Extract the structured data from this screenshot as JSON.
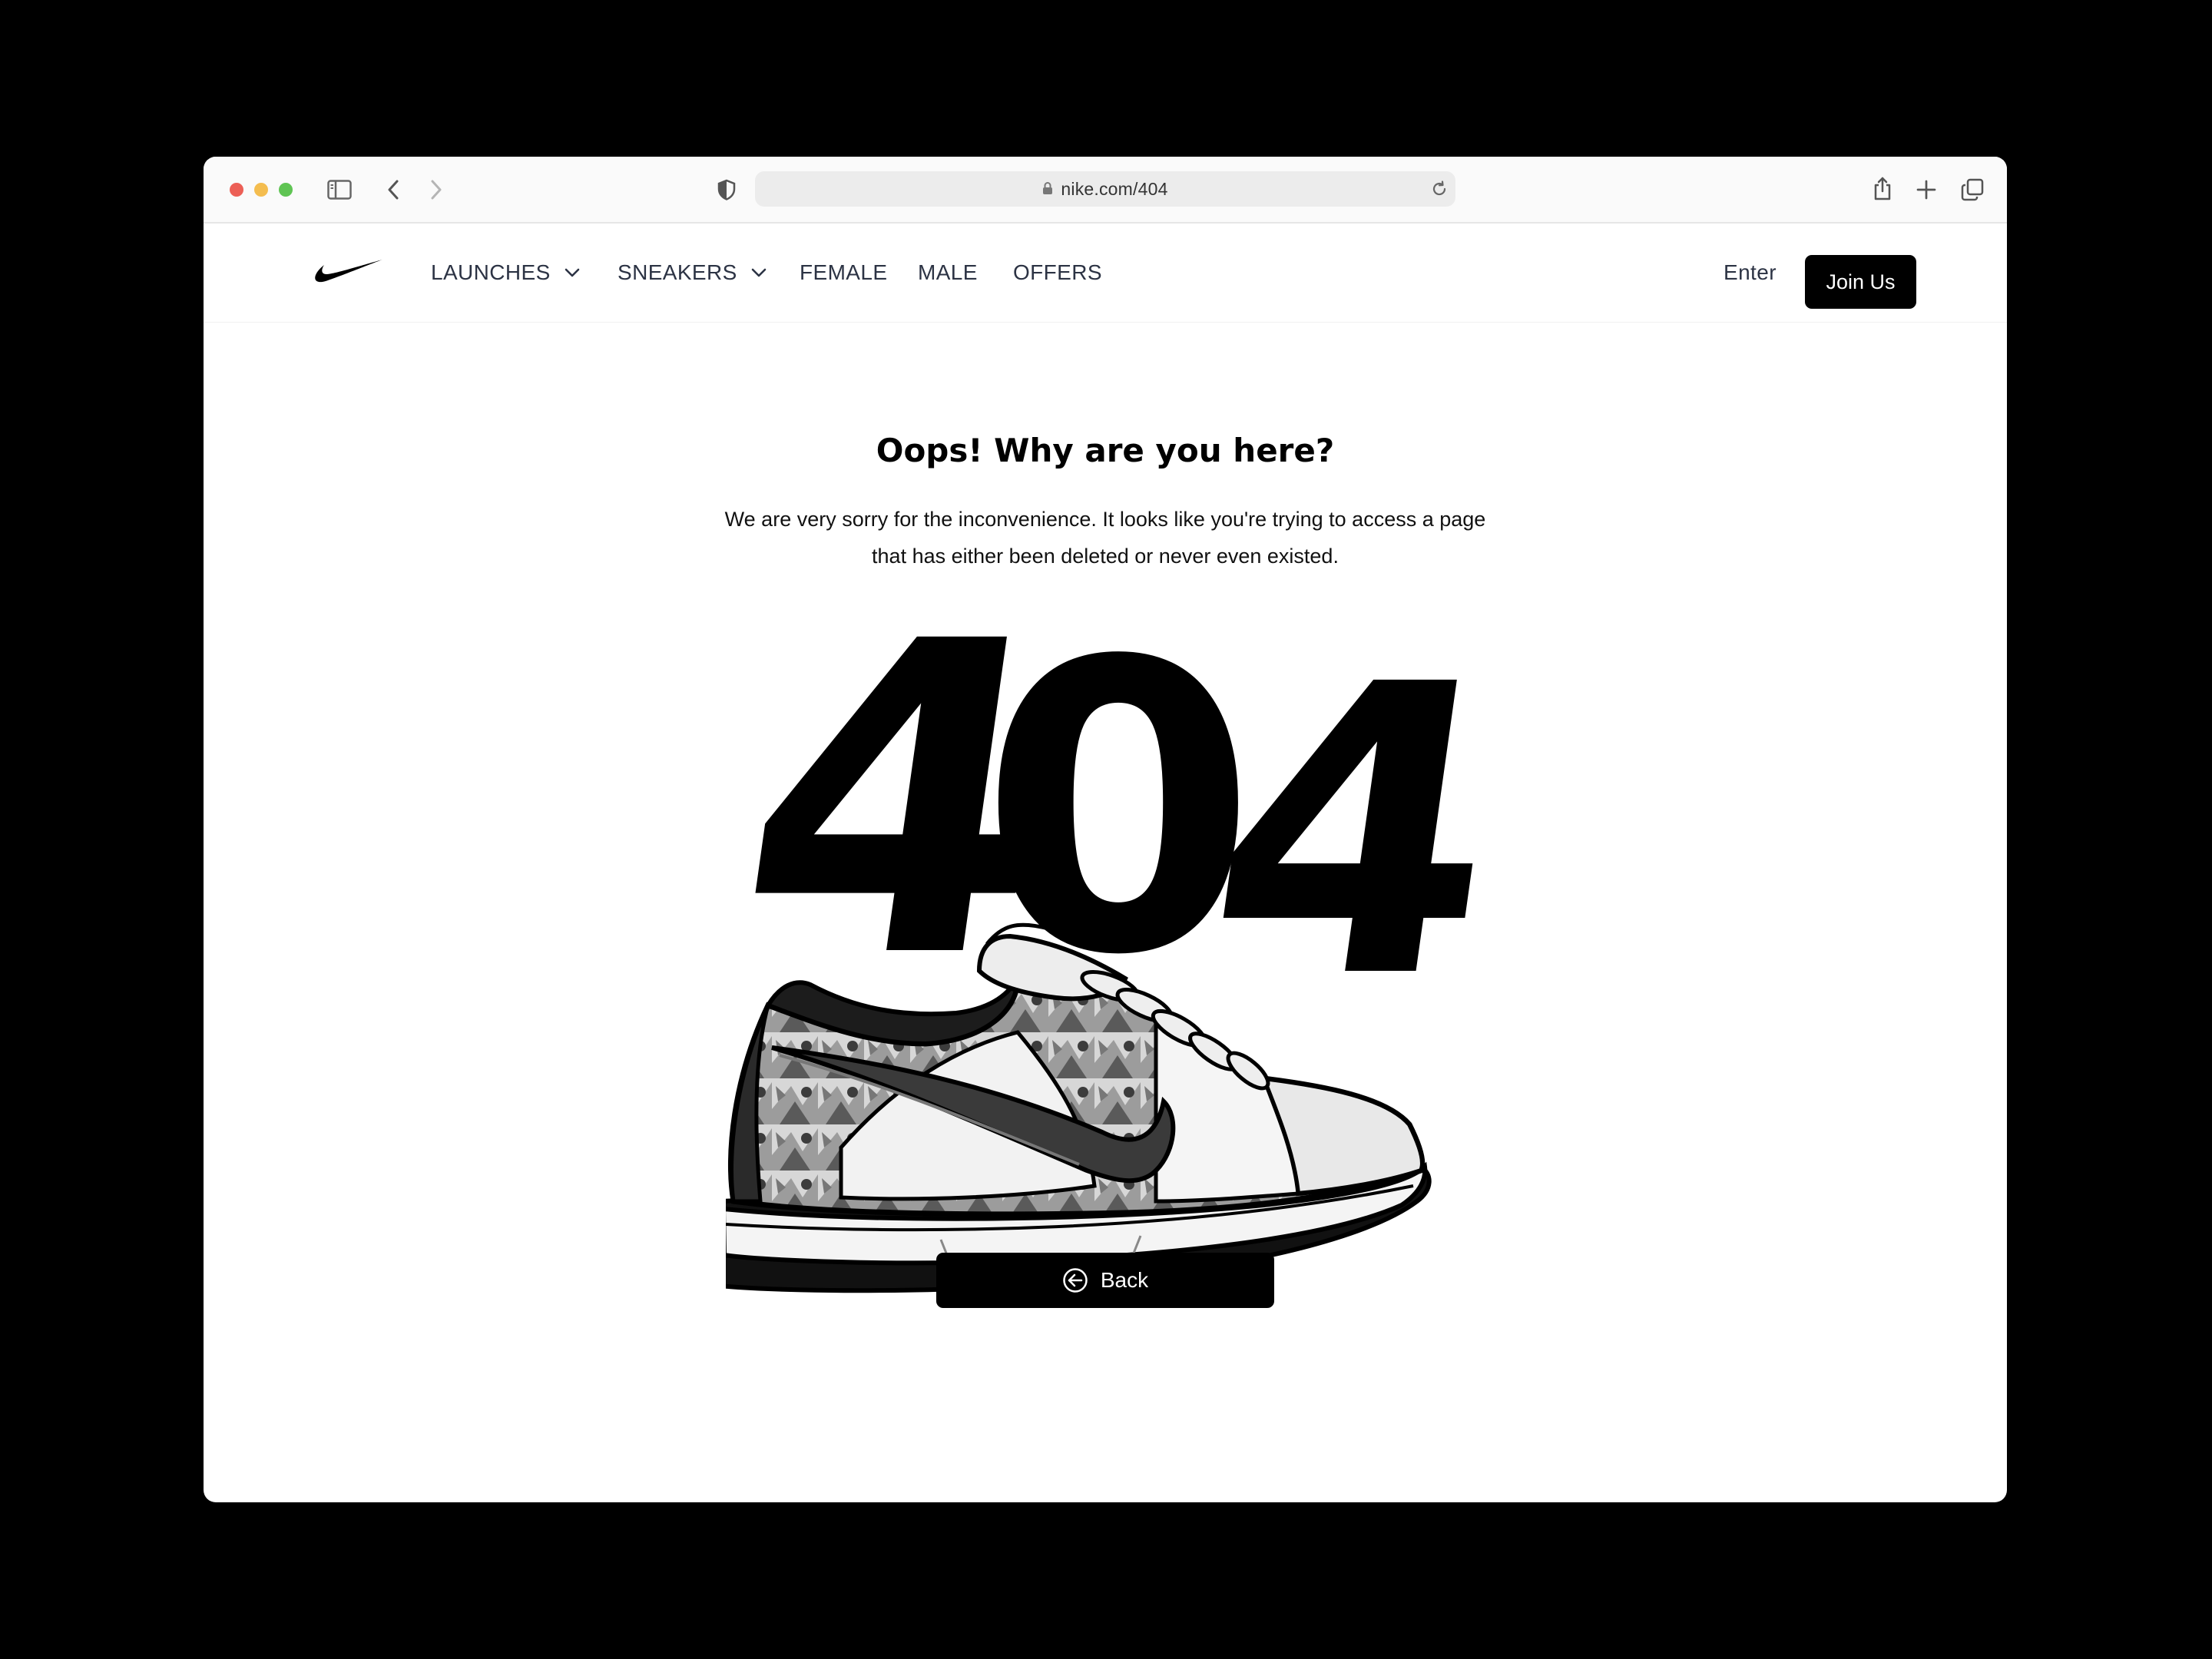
{
  "browser": {
    "url": "nike.com/404"
  },
  "nav": {
    "items": [
      {
        "label": "LAUNCHES",
        "has_dropdown": true
      },
      {
        "label": "SNEAKERS",
        "has_dropdown": true
      },
      {
        "label": "FEMALE",
        "has_dropdown": false
      },
      {
        "label": "MALE",
        "has_dropdown": false
      },
      {
        "label": "OFFERS",
        "has_dropdown": false
      }
    ],
    "enter_label": "Enter",
    "join_label": "Join Us"
  },
  "main": {
    "title": "Oops! Why are you here?",
    "description_line1": "We are very sorry for the inconvenience. It looks like you're trying to access a page",
    "description_line2": "that has either been deleted or never even existed.",
    "digit_1": "4",
    "digit_2": "0",
    "digit_3": "4",
    "back_label": "Back"
  },
  "colors": {
    "accent": "#000000",
    "nav_text": "#2c3344",
    "traffic_red": "#ec5f56",
    "traffic_yellow": "#f4bd4f",
    "traffic_green": "#5fc453"
  },
  "icons": [
    "sidebar-icon",
    "back-arrow-icon",
    "forward-arrow-icon",
    "shield-icon",
    "lock-icon",
    "reload-icon",
    "share-icon",
    "plus-icon",
    "tabs-icon",
    "nike-swoosh-logo",
    "chevron-down-icon",
    "arrow-left-circle-icon"
  ]
}
